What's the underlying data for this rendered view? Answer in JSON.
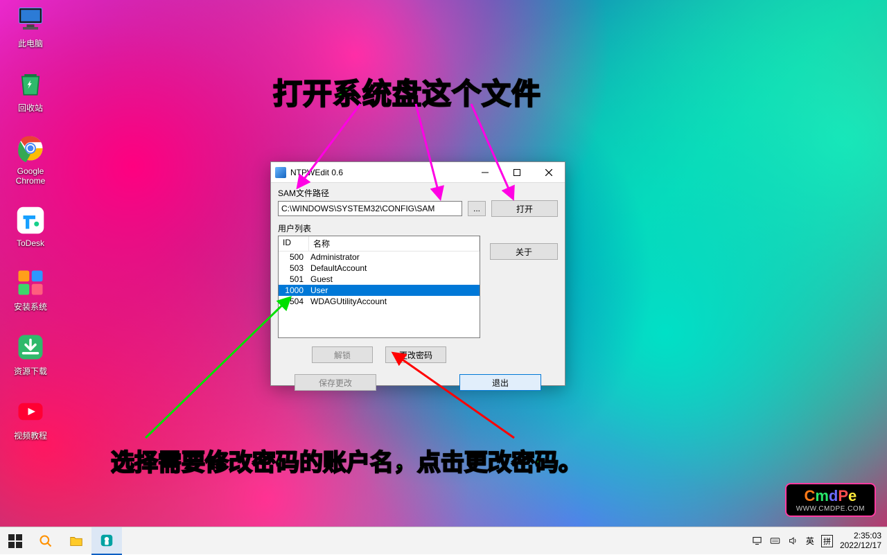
{
  "desktop": {
    "icons": [
      {
        "label": "此电脑",
        "name": "desktop-icon-this-pc"
      },
      {
        "label": "回收站",
        "name": "desktop-icon-recycle-bin"
      },
      {
        "label": "Google\nChrome",
        "name": "desktop-icon-chrome"
      },
      {
        "label": "ToDesk",
        "name": "desktop-icon-todesk"
      },
      {
        "label": "安装系统",
        "name": "desktop-icon-install-os"
      },
      {
        "label": "资源下载",
        "name": "desktop-icon-downloads"
      },
      {
        "label": "视频教程",
        "name": "desktop-icon-video-tutorial"
      }
    ]
  },
  "annotations": {
    "top": "打开系统盘这个文件",
    "bottom": "选择需要修改密码的账户名，点击更改密码。"
  },
  "watermark": {
    "line1_c": "C",
    "line1_m": "m",
    "line1_d": "d",
    "line1_p": "P",
    "line1_e": "e",
    "line2": "WWW.CMDPE.COM"
  },
  "window": {
    "title": "NTPWEdit 0.6",
    "sam_label": "SAM文件路径",
    "sam_path": "C:\\WINDOWS\\SYSTEM32\\CONFIG\\SAM",
    "browse": "...",
    "open": "打开",
    "userlist_label": "用户列表",
    "col_id": "ID",
    "col_name": "名称",
    "users": [
      {
        "id": "500",
        "name": "Administrator"
      },
      {
        "id": "503",
        "name": "DefaultAccount"
      },
      {
        "id": "501",
        "name": "Guest"
      },
      {
        "id": "1000",
        "name": "User",
        "selected": true
      },
      {
        "id": "504",
        "name": "WDAGUtilityAccount"
      }
    ],
    "about": "关于",
    "unlock": "解锁",
    "change_pw": "更改密码",
    "save": "保存更改",
    "exit": "退出"
  },
  "taskbar": {
    "ime": "英",
    "ime2": "拼",
    "time": "2:35:03",
    "date": "2022/12/17"
  }
}
